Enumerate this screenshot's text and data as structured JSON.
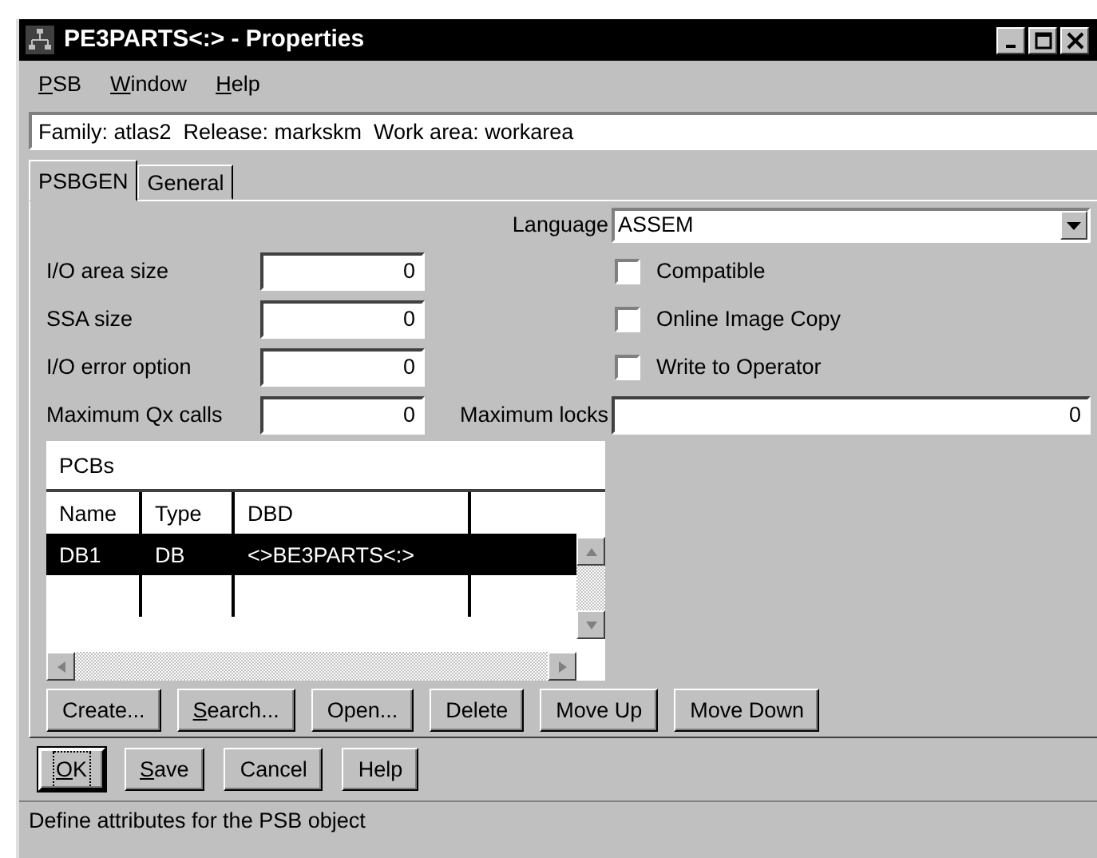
{
  "window": {
    "title": "PE3PARTS<:> - Properties"
  },
  "menu": [
    {
      "label": "PSB",
      "accel": true
    },
    {
      "label": "Window",
      "accel": true
    },
    {
      "label": "Help",
      "accel": true
    }
  ],
  "context": "Family: atlas2  Release: markskm  Work area: workarea",
  "tabs": [
    {
      "label": "PSBGEN",
      "selected": true
    },
    {
      "label": "General",
      "selected": false
    }
  ],
  "language": {
    "label": "Language",
    "value": "ASSEM"
  },
  "fields": [
    {
      "label": "I/O area size",
      "value": "0"
    },
    {
      "label": "SSA size",
      "value": "0"
    },
    {
      "label": "I/O error option",
      "value": "0"
    },
    {
      "label": "Maximum Qx calls",
      "value": "0"
    }
  ],
  "options": [
    {
      "label": "Compatible",
      "checked": false
    },
    {
      "label": "Online Image Copy",
      "checked": false
    },
    {
      "label": "Write to Operator",
      "checked": false
    }
  ],
  "max_locks": {
    "label": "Maximum locks",
    "value": "0"
  },
  "pcbs": {
    "title": "PCBs",
    "columns": [
      "Name",
      "Type",
      "DBD"
    ],
    "rows": [
      {
        "cells": [
          "DB1",
          "DB",
          "<>BE3PARTS<:>"
        ],
        "selected": true
      }
    ]
  },
  "pcb_buttons": [
    {
      "label": "Create...",
      "accel": false
    },
    {
      "label": "Search...",
      "accel": true
    },
    {
      "label": "Open...",
      "accel": false
    },
    {
      "label": "Delete",
      "accel": false
    },
    {
      "label": "Move Up",
      "accel": false
    },
    {
      "label": "Move Down",
      "accel": false
    }
  ],
  "dialog_buttons": [
    {
      "label": "OK",
      "accel": true,
      "default": true
    },
    {
      "label": "Save",
      "accel": true,
      "default": false
    },
    {
      "label": "Cancel",
      "accel": false,
      "default": false
    },
    {
      "label": "Help",
      "accel": false,
      "default": false
    }
  ],
  "status_bar": "Define attributes for the PSB object"
}
